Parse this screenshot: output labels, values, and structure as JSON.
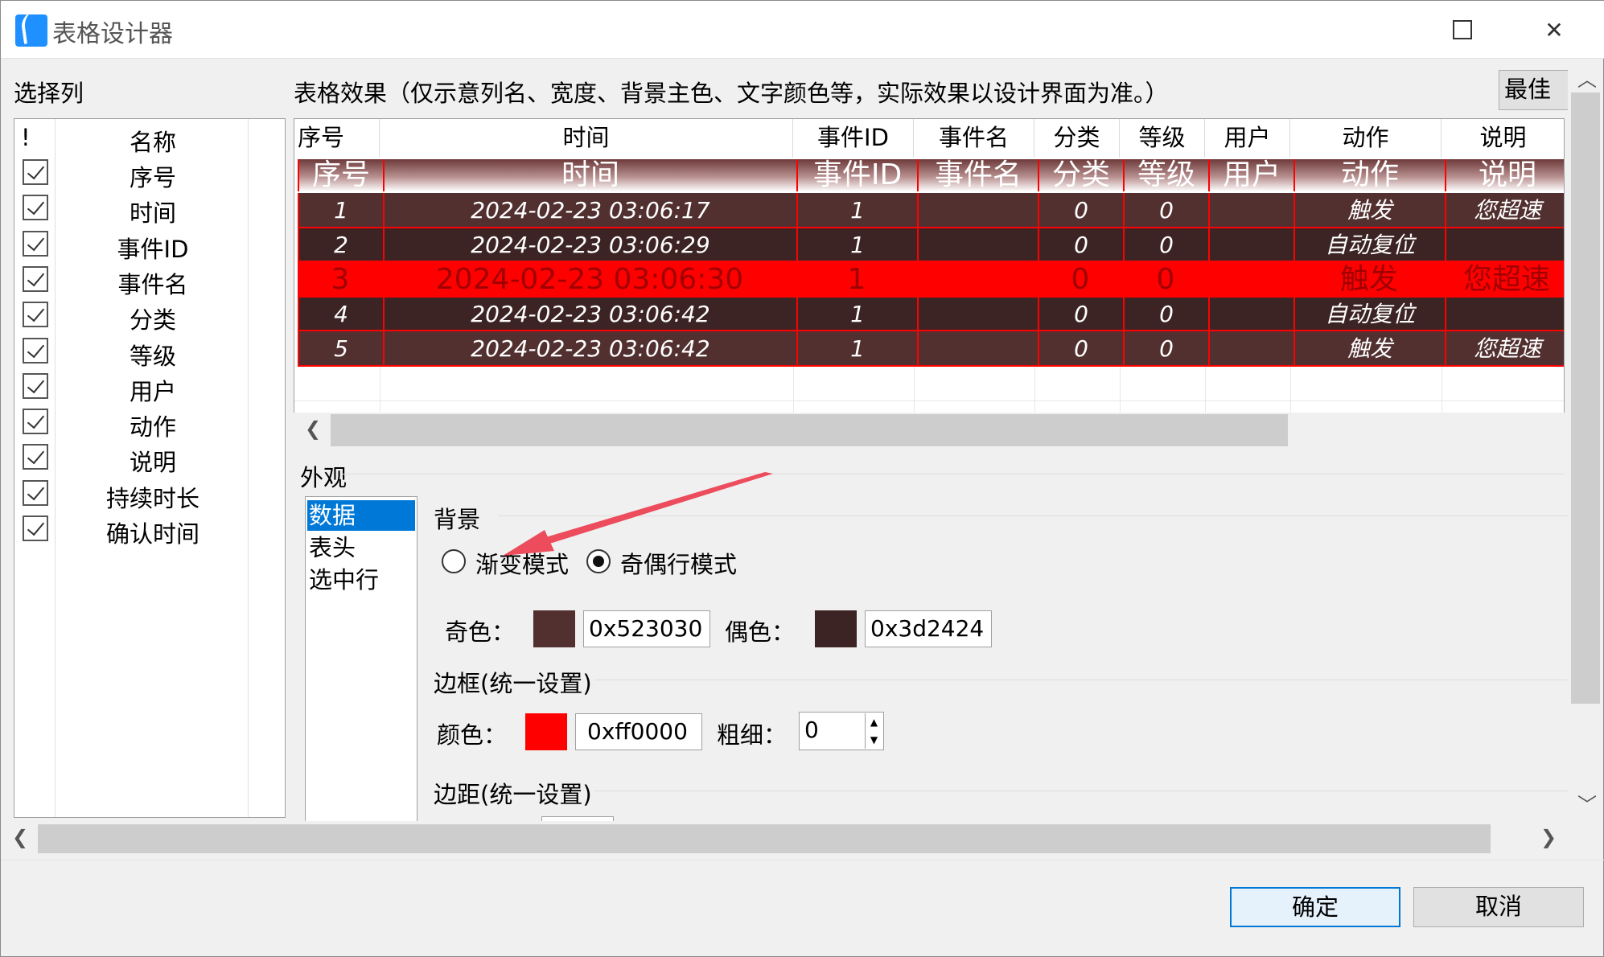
{
  "window": {
    "title": "表格设计器"
  },
  "select_columns": {
    "label": "选择列",
    "header_flag": "!",
    "header_name": "名称",
    "items": [
      {
        "label": "序号",
        "checked": true
      },
      {
        "label": "时间",
        "checked": true
      },
      {
        "label": "事件ID",
        "checked": true
      },
      {
        "label": "事件名",
        "checked": true
      },
      {
        "label": "分类",
        "checked": true
      },
      {
        "label": "等级",
        "checked": true
      },
      {
        "label": "用户",
        "checked": true
      },
      {
        "label": "动作",
        "checked": true
      },
      {
        "label": "说明",
        "checked": true
      },
      {
        "label": "持续时长",
        "checked": true
      },
      {
        "label": "确认时间",
        "checked": true
      }
    ]
  },
  "preview": {
    "label": "表格效果（仅示意列名、宽度、背景主色、文字颜色等，实际效果以设计界面为准。）",
    "best_fit_button": "最佳列",
    "columns": [
      "序号",
      "时间",
      "事件ID",
      "事件名",
      "分类",
      "等级",
      "用户",
      "动作",
      "说明"
    ],
    "rows": [
      [
        "1",
        "2024-02-23 03:06:17",
        "1",
        "",
        "0",
        "0",
        "",
        "触发",
        "您超速"
      ],
      [
        "2",
        "2024-02-23 03:06:29",
        "1",
        "",
        "0",
        "0",
        "",
        "自动复位",
        ""
      ],
      [
        "3",
        "2024-02-23 03:06:30",
        "1",
        "",
        "0",
        "0",
        "",
        "触发",
        "您超速"
      ],
      [
        "4",
        "2024-02-23 03:06:42",
        "1",
        "",
        "0",
        "0",
        "",
        "自动复位",
        ""
      ],
      [
        "5",
        "2024-02-23 03:06:42",
        "1",
        "",
        "0",
        "0",
        "",
        "触发",
        "您超速"
      ]
    ],
    "selected_row": 2,
    "odd_color": "#523030",
    "even_color": "#3d2424",
    "border_color": "#ff0000",
    "selected_bg": "#ff0000"
  },
  "appearance": {
    "label": "外观",
    "categories": [
      "数据",
      "表头",
      "选中行"
    ],
    "selected_category": "数据",
    "background": {
      "label": "背景",
      "gradient_mode": "渐变模式",
      "odd_even_mode": "奇偶行模式",
      "selected_mode": "奇偶行模式",
      "odd_label": "奇色：",
      "odd_value": "0x523030",
      "even_label": "偶色：",
      "even_value": "0x3d2424"
    },
    "border": {
      "label": "边框(统一设置)",
      "color_label": "颜色：",
      "color_value": "0xff0000",
      "thickness_label": "粗细：",
      "thickness_value": "0"
    },
    "margin": {
      "label": "边距(统一设置)"
    }
  },
  "buttons": {
    "ok": "确定",
    "cancel": "取消"
  }
}
